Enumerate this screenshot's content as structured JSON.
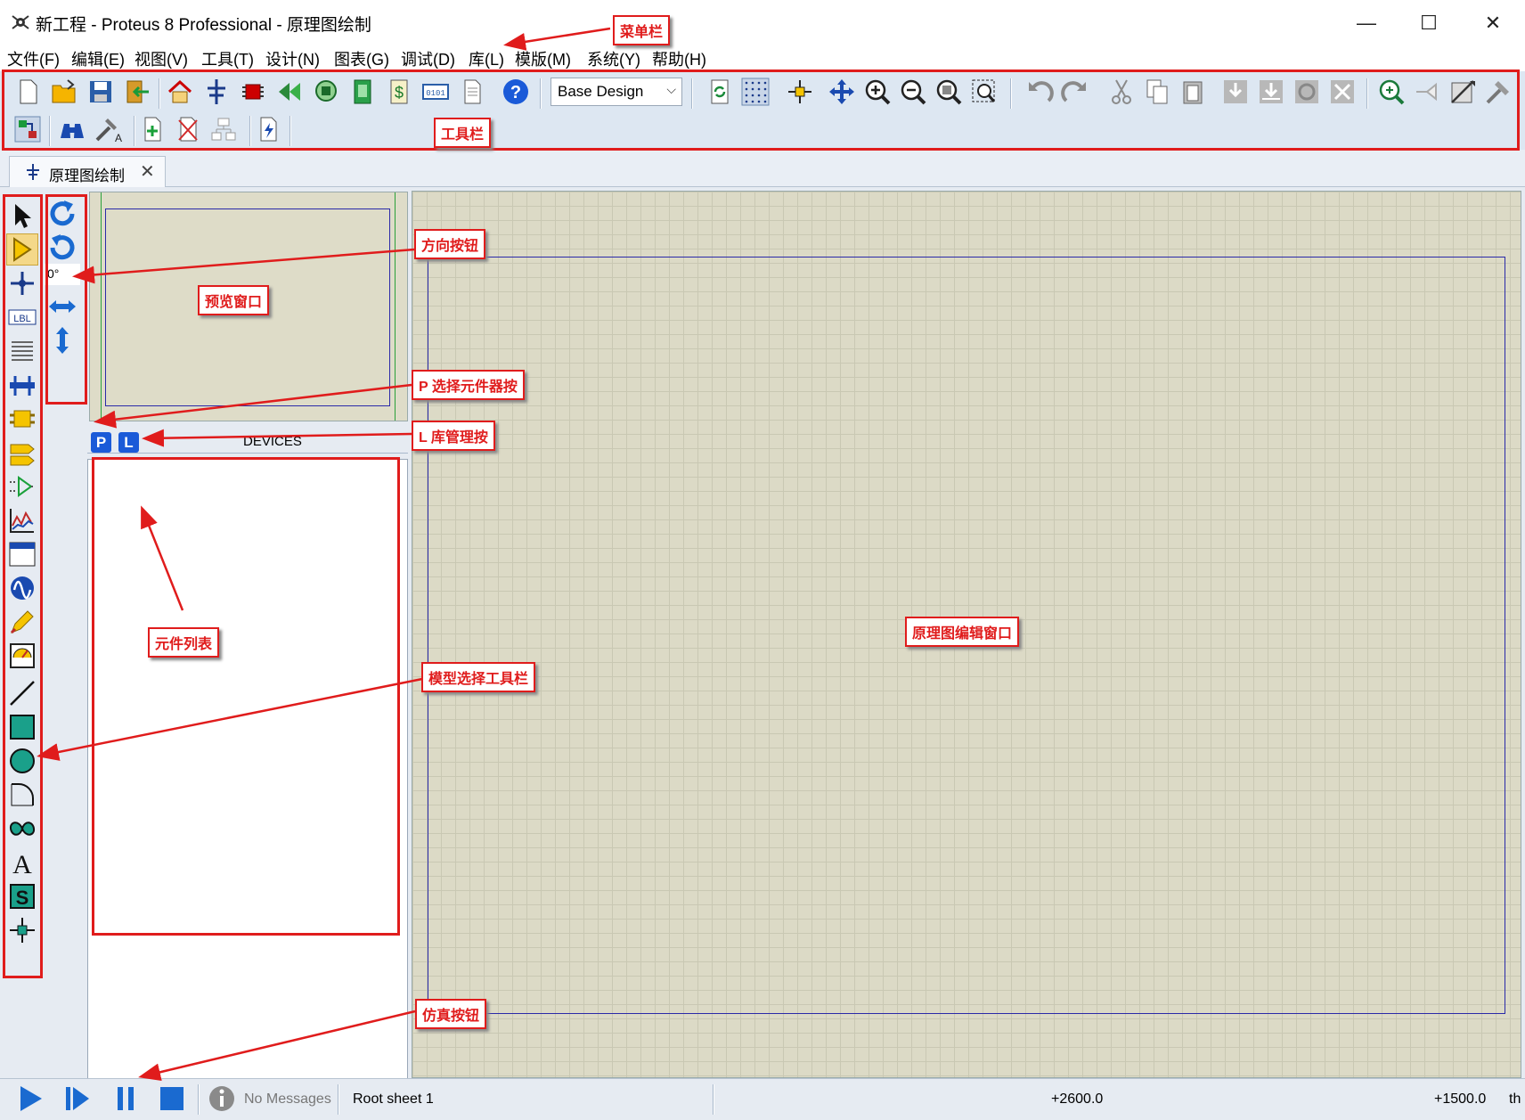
{
  "window": {
    "title": "新工程 - Proteus 8 Professional - 原理图绘制",
    "minimize_glyph": "—",
    "maximize_glyph": "☐",
    "close_glyph": "✕"
  },
  "menu": {
    "items": [
      "文件(F)",
      "编辑(E)",
      "视图(V)",
      "工具(T)",
      "设计(N)",
      "图表(G)",
      "调试(D)",
      "库(L)",
      "模版(M)",
      "系统(Y)",
      "帮助(H)"
    ]
  },
  "toolbar": {
    "design_combo_value": "Base Design"
  },
  "tab": {
    "label": "原理图绘制",
    "close_glyph": "✕"
  },
  "orientation": {
    "angle": "0°"
  },
  "devices": {
    "p_label": "P",
    "l_label": "L",
    "header": "DEVICES"
  },
  "status": {
    "messages": "No Messages",
    "sheet": "Root sheet 1",
    "x_coord": "+2600.0",
    "y_coord": "+1500.0",
    "unit": "th"
  },
  "annotations": {
    "menubar": "菜单栏",
    "toolbar": "工具栏",
    "orientation": "方向按钮",
    "preview": "预览窗口",
    "pick_devices": "P 选择元件器按",
    "library": "L 库管理按",
    "device_list": "元件列表",
    "mode_toolbar": "模型选择工具栏",
    "editor": "原理图编辑窗口",
    "simulation": "仿真按钮"
  },
  "colors": {
    "annotation": "#e01c1c",
    "canvas": "#dcdac6",
    "sheet_border": "#2a2aa8",
    "toolbar": "#dde7f2"
  }
}
